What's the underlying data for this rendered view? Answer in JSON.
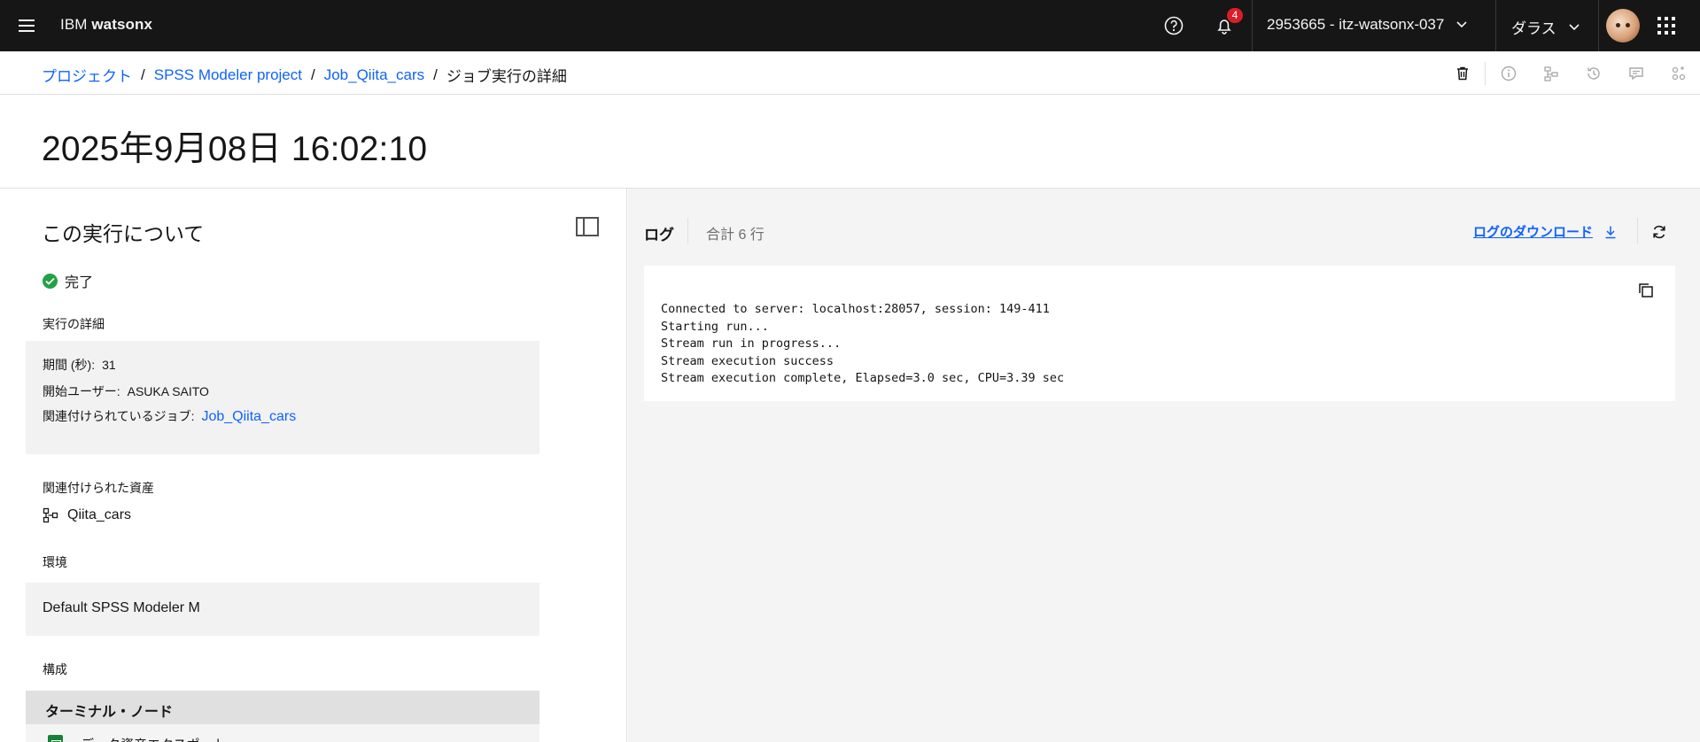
{
  "topbar": {
    "menu_icon": "hamburger-menu-icon",
    "brand_prefix": "IBM ",
    "brand_name": "watsonx",
    "help_icon": "help-icon",
    "notification_icon": "bell-icon",
    "notification_count": "4",
    "account_label": "2953665 - itz-watsonx-037",
    "region_label": "ダラス",
    "avatar_icon": "user-avatar",
    "apps_icon": "app-switcher-icon"
  },
  "breadcrumb": {
    "items": [
      "プロジェクト",
      "SPSS Modeler project",
      "Job_Qiita_cars"
    ],
    "separator": "/",
    "current": "ジョブ実行の詳細"
  },
  "toolbar": {
    "icons": [
      "trash-icon",
      "information-icon",
      "tree-view-icon",
      "history-icon",
      "comment-icon",
      "apps-grid-icon"
    ]
  },
  "page": {
    "title": "2025年9月08日 16:02:10"
  },
  "about": {
    "title": "この実行について",
    "status": "完了",
    "status_color": "#24a148",
    "details_label": "実行の詳細",
    "duration_label": "期間 (秒):",
    "duration_value": "31",
    "started_by_label": "開始ユーザー:",
    "started_by_value": "ASUKA SAITO",
    "job_label": "関連付けられているジョブ:",
    "job_value": "Job_Qiita_cars",
    "assets_label": "関連付けられた資産",
    "asset_name": "Qiita_cars",
    "environment_label": "環境",
    "environment_value": "Default SPSS Modeler M",
    "config_label": "構成",
    "terminal_nodes_header": "ターミナル・ノード",
    "terminal_node_item": "データ資産エクスポート"
  },
  "log": {
    "tab_label": "ログ",
    "total_lines": "合計 6 行",
    "download_label": "ログのダウンロード",
    "lines": [
      "",
      "Connected to server: localhost:28057, session: 149-411",
      "Starting run...",
      "Stream run in progress...",
      "Stream execution success",
      "Stream execution complete, Elapsed=3.0 sec, CPU=3.39 sec"
    ]
  },
  "colors": {
    "link": "#0f62fe",
    "topbar_bg": "#161616",
    "badge": "#da1e28"
  }
}
